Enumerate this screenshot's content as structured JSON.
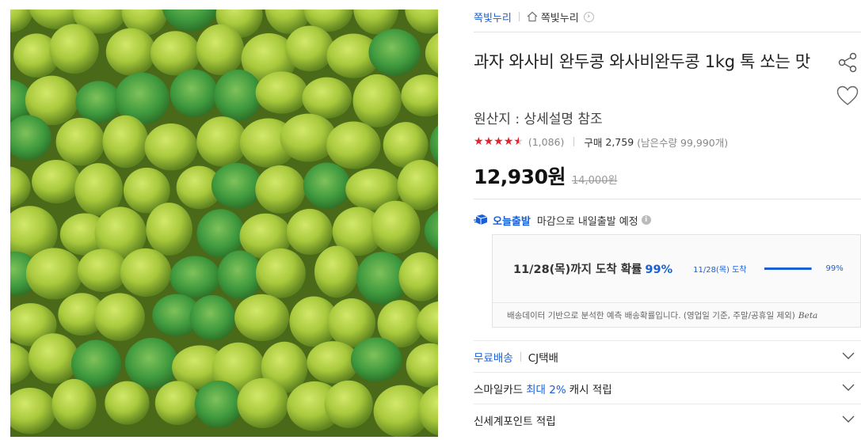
{
  "breadcrumb": {
    "store": "쪽빛누리",
    "store_home": "쪽빛누리"
  },
  "product": {
    "title": "과자 와사비 완두콩 와사비완두콩 1kg 톡 쏘는 맛",
    "origin": "원산지 : 상세설명 참조",
    "rating": 4.5,
    "review_count": "(1,086)",
    "buy_label": "구매",
    "buy_count": "2,759",
    "remain": "(남은수량 99,990개)",
    "price": "12,930원",
    "original_price": "14,000원"
  },
  "today_delivery": {
    "label": "오늘출발",
    "desc": "마감으로 내일출발 예정",
    "arrive_text": "11/28(목)까지 도착 확률",
    "arrive_pct": "99%",
    "mini_date": "11/28(목) 도착",
    "mini_pct": "99%",
    "mini_fraction": 0.99,
    "note": "배송데이터 기반으로 분석한 예측 배송확률입니다. (영업일 기준, 주말/공휴일 제외)",
    "beta": "Beta"
  },
  "options": {
    "shipping_free": "무료배송",
    "shipping_carrier": "CJ택배",
    "card_prefix": "스마일카드",
    "card_highlight": "최대 2%",
    "card_suffix": "캐시 적립",
    "points": "신세계포인트 적립"
  },
  "colors": {
    "accent_blue": "#1a5fd6",
    "star_red": "#e5222c"
  },
  "icons": [
    "home-icon",
    "arrow-right-icon",
    "share-icon",
    "heart-icon",
    "truck-icon",
    "info-icon",
    "chevron-down-icon"
  ]
}
